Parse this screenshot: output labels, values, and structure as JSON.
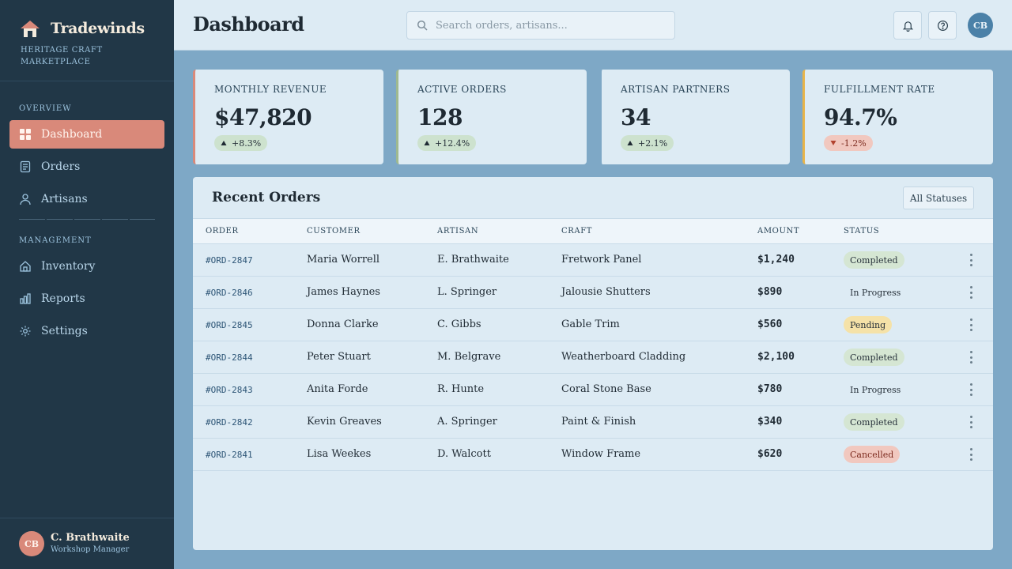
{
  "app": {
    "name": "Tradewinds",
    "tagline": "HERITAGE CRAFT MARKETPLACE"
  },
  "sidebar": {
    "sections": [
      {
        "label": "OVERVIEW"
      },
      {
        "label": "MANAGEMENT"
      }
    ],
    "items": [
      {
        "label": "Dashboard",
        "icon": "grid-icon",
        "active": true
      },
      {
        "label": "Orders",
        "icon": "document-icon"
      },
      {
        "label": "Artisans",
        "icon": "person-icon"
      },
      {
        "label": "Inventory",
        "icon": "home-icon"
      },
      {
        "label": "Reports",
        "icon": "bar-chart-icon"
      },
      {
        "label": "Settings",
        "icon": "gear-icon"
      }
    ],
    "user": {
      "initials": "CB",
      "name": "C. Brathwaite",
      "role": "Workshop Manager"
    }
  },
  "header": {
    "title": "Dashboard",
    "search_placeholder": "Search orders, artisans...",
    "avatar_initials": "CB"
  },
  "stats": [
    {
      "label": "MONTHLY REVENUE",
      "value": "$47,820",
      "change": "+8.3%",
      "direction": "up",
      "accent": "#d9897a"
    },
    {
      "label": "ACTIVE ORDERS",
      "value": "128",
      "change": "+12.4%",
      "direction": "up",
      "accent": "#9fb98f"
    },
    {
      "label": "ARTISAN PARTNERS",
      "value": "34",
      "change": "+2.1%",
      "direction": "up",
      "accent": "#7ea8c6"
    },
    {
      "label": "FULFILLMENT RATE",
      "value": "94.7%",
      "change": "-1.2%",
      "direction": "down",
      "accent": "#e7b44a"
    }
  ],
  "orders": {
    "title": "Recent Orders",
    "filter_label": "All Statuses",
    "columns": [
      "ORDER",
      "CUSTOMER",
      "ARTISAN",
      "CRAFT",
      "AMOUNT",
      "STATUS"
    ],
    "rows": [
      {
        "id": "#ORD-2847",
        "customer": "Maria Worrell",
        "artisan": "E. Brathwaite",
        "craft": "Fretwork Panel",
        "amount": "$1,240",
        "status": "Completed"
      },
      {
        "id": "#ORD-2846",
        "customer": "James Haynes",
        "artisan": "L. Springer",
        "craft": "Jalousie Shutters",
        "amount": "$890",
        "status": "In Progress"
      },
      {
        "id": "#ORD-2845",
        "customer": "Donna Clarke",
        "artisan": "C. Gibbs",
        "craft": "Gable Trim",
        "amount": "$560",
        "status": "Pending"
      },
      {
        "id": "#ORD-2844",
        "customer": "Peter Stuart",
        "artisan": "M. Belgrave",
        "craft": "Weatherboard Cladding",
        "amount": "$2,100",
        "status": "Completed"
      },
      {
        "id": "#ORD-2843",
        "customer": "Anita Forde",
        "artisan": "R. Hunte",
        "craft": "Coral Stone Base",
        "amount": "$780",
        "status": "In Progress"
      },
      {
        "id": "#ORD-2842",
        "customer": "Kevin Greaves",
        "artisan": "A. Springer",
        "craft": "Paint & Finish",
        "amount": "$340",
        "status": "Completed"
      },
      {
        "id": "#ORD-2841",
        "customer": "Lisa Weekes",
        "artisan": "D. Walcott",
        "craft": "Window Frame",
        "amount": "$620",
        "status": "Cancelled"
      }
    ]
  },
  "colors": {
    "sidebar_bg": "#213747",
    "accent": "#d9897a",
    "page_bg": "#7ea8c6",
    "surface": "#ddebf4"
  }
}
